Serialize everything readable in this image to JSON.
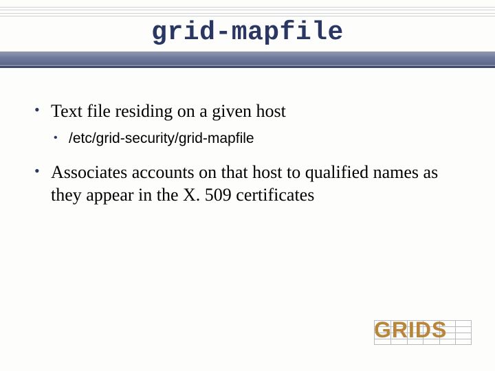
{
  "title": "grid-mapfile",
  "bullets": [
    {
      "text": "Text file residing on a given host",
      "children": [
        {
          "text": "/etc/grid-security/grid-mapfile"
        }
      ]
    },
    {
      "text": "Associates accounts on that host to qualified names as they appear in the X. 509 certificates",
      "children": []
    }
  ],
  "logo": {
    "text": "GRIDS"
  }
}
